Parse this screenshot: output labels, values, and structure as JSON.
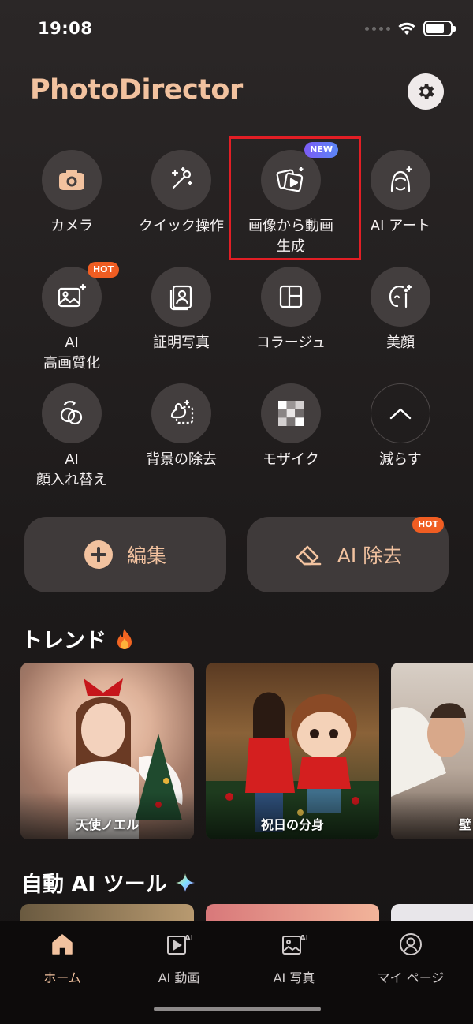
{
  "status_bar": {
    "time": "19:08"
  },
  "app": {
    "title": "PhotoDirector"
  },
  "tools": [
    {
      "label": "カメラ",
      "icon": "camera-icon"
    },
    {
      "label": "クイック操作",
      "icon": "magic-wand-icon"
    },
    {
      "label": "画像から動画\n生成",
      "icon": "image-to-video-icon",
      "badge": "NEW",
      "highlighted": true
    },
    {
      "label": "AI アート",
      "icon": "ai-art-icon"
    },
    {
      "label": "AI\n高画質化",
      "icon": "image-enhance-icon",
      "badge": "HOT"
    },
    {
      "label": "証明写真",
      "icon": "id-photo-icon"
    },
    {
      "label": "コラージュ",
      "icon": "collage-icon"
    },
    {
      "label": "美顔",
      "icon": "beauty-face-icon"
    },
    {
      "label": "AI\n顔入れ替え",
      "icon": "face-swap-icon"
    },
    {
      "label": "背景の除去",
      "icon": "background-remove-icon"
    },
    {
      "label": "モザイク",
      "icon": "mosaic-icon"
    },
    {
      "label": "減らす",
      "icon": "chevron-up-icon"
    }
  ],
  "actions": {
    "edit_label": "編集",
    "ai_remove_label": "AI 除去",
    "ai_remove_badge": "HOT"
  },
  "trend": {
    "title": "トレンド",
    "cards": [
      {
        "label": "天使ノエル"
      },
      {
        "label": "祝日の分身"
      },
      {
        "label": "壁ド"
      }
    ]
  },
  "auto_ai": {
    "title": "自動 AI ツール"
  },
  "tabbar": {
    "tabs": [
      {
        "label": "ホーム",
        "active": true
      },
      {
        "label": "AI 動画"
      },
      {
        "label": "AI 写真"
      },
      {
        "label": "マイ ページ"
      }
    ]
  },
  "colors": {
    "accent": "#f2c29f",
    "hot_badge": "#f05d22",
    "new_badge": "#6f6ef5",
    "highlight_box": "#e21e25"
  }
}
